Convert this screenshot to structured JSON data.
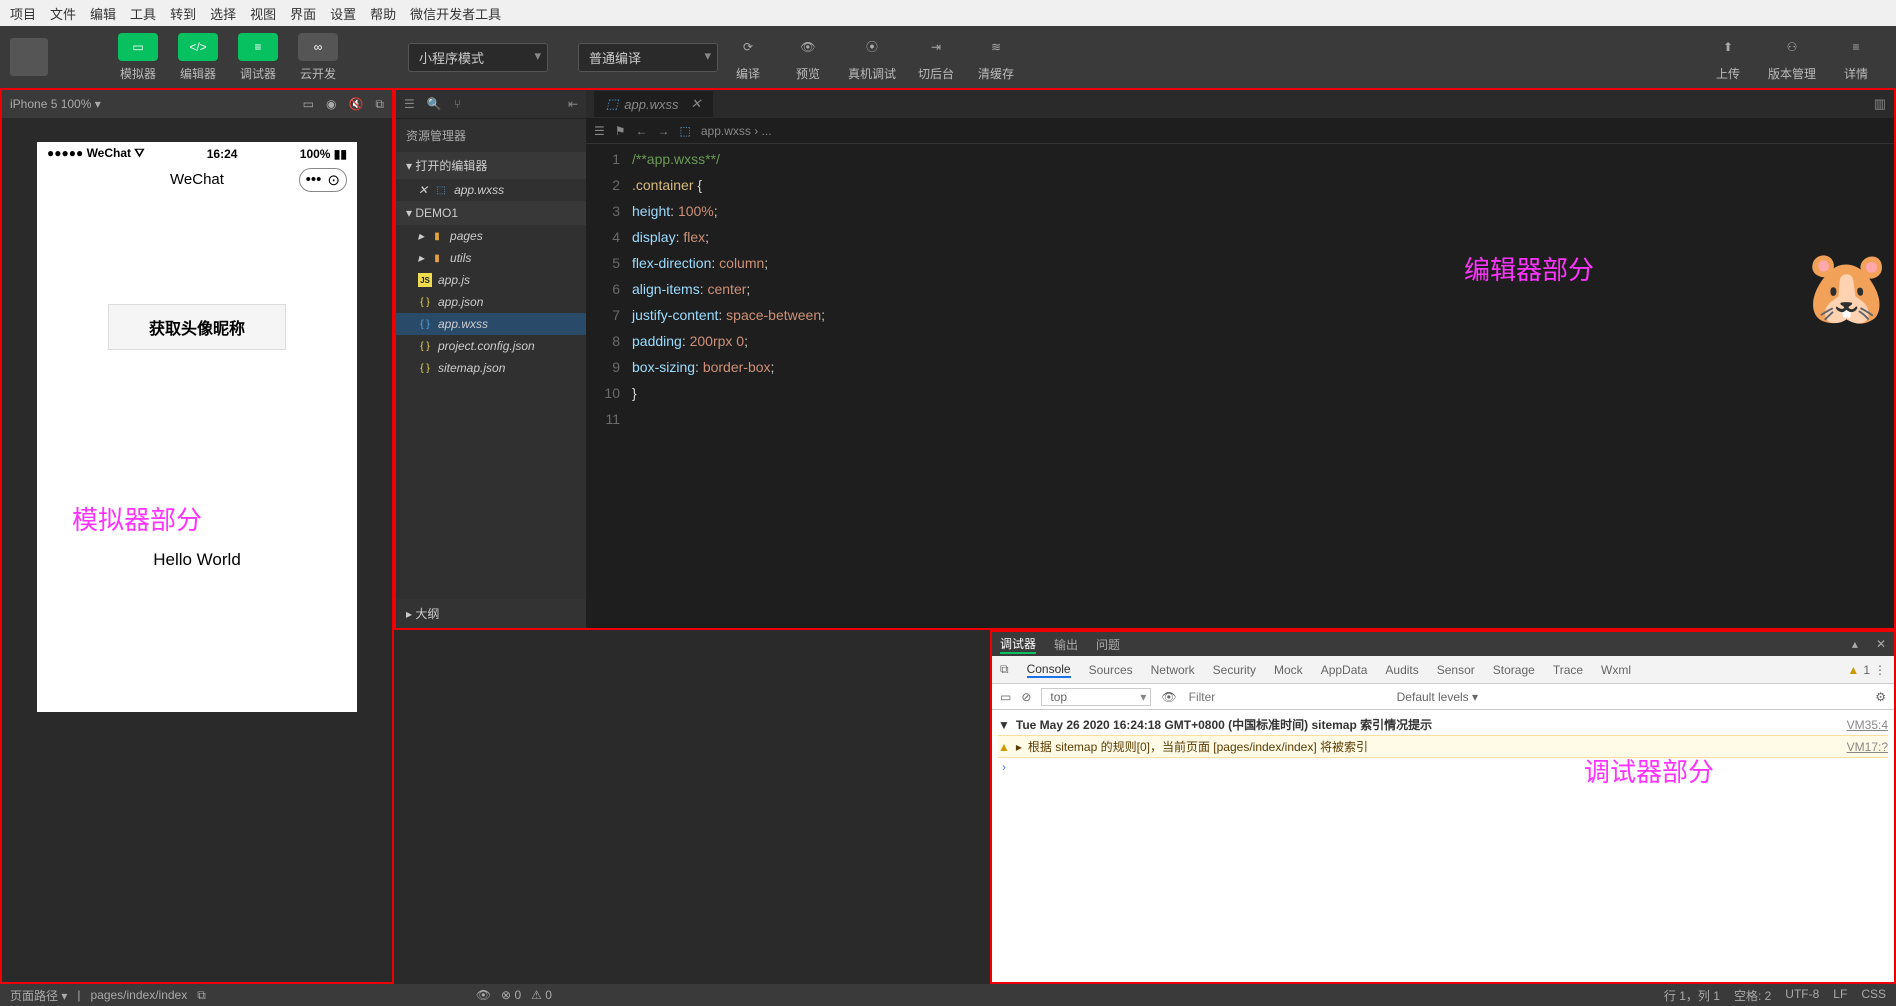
{
  "menubar": [
    "项目",
    "文件",
    "编辑",
    "工具",
    "转到",
    "选择",
    "视图",
    "界面",
    "设置",
    "帮助",
    "微信开发者工具"
  ],
  "toolbar": {
    "simulator": "模拟器",
    "editor": "编辑器",
    "debugger": "调试器",
    "cloud": "云开发",
    "mode_select": "小程序模式",
    "compile_select": "普通编译",
    "compile": "编译",
    "preview": "预览",
    "remote": "真机调试",
    "background": "切后台",
    "clear_cache": "清缓存",
    "upload": "上传",
    "version": "版本管理",
    "details": "详情"
  },
  "simulator": {
    "device": "iPhone 5 100% ▾",
    "status_carrier": "●●●●● WeChat ⛛",
    "status_time": "16:24",
    "status_batt": "100% ▮▮",
    "nav_title": "WeChat",
    "btn_label": "获取头像昵称",
    "hello": "Hello World",
    "annotation": "模拟器部分"
  },
  "explorer": {
    "title": "资源管理器",
    "open_editors": "打开的编辑器",
    "open_file": "app.wxss",
    "project": "DEMO1",
    "tree": [
      {
        "icon": "folder",
        "label": "pages"
      },
      {
        "icon": "folder",
        "label": "utils"
      },
      {
        "icon": "js",
        "label": "app.js"
      },
      {
        "icon": "json",
        "label": "app.json"
      },
      {
        "icon": "wxss",
        "label": "app.wxss",
        "active": true
      },
      {
        "icon": "json",
        "label": "project.config.json"
      },
      {
        "icon": "json",
        "label": "sitemap.json"
      }
    ],
    "outline": "大纲"
  },
  "editor": {
    "tab": "app.wxss",
    "breadcrumb": "app.wxss › ...",
    "lines": [
      {
        "n": 1,
        "html": "<span class='c-comment'>/**app.wxss**/</span>"
      },
      {
        "n": 2,
        "html": "<span class='c-sel'>.container</span> <span class='c-brace'>{</span>"
      },
      {
        "n": 3,
        "html": "  <span class='c-prop'>height</span><span class='c-punc'>:</span> <span class='c-val'>100%</span><span class='c-punc'>;</span>"
      },
      {
        "n": 4,
        "html": "  <span class='c-prop'>display</span><span class='c-punc'>:</span> <span class='c-val'>flex</span><span class='c-punc'>;</span>"
      },
      {
        "n": 5,
        "html": "  <span class='c-prop'>flex-direction</span><span class='c-punc'>:</span> <span class='c-val'>column</span><span class='c-punc'>;</span>"
      },
      {
        "n": 6,
        "html": "  <span class='c-prop'>align-items</span><span class='c-punc'>:</span> <span class='c-val'>center</span><span class='c-punc'>;</span>"
      },
      {
        "n": 7,
        "html": "  <span class='c-prop'>justify-content</span><span class='c-punc'>:</span> <span class='c-val'>space-between</span><span class='c-punc'>;</span>"
      },
      {
        "n": 8,
        "html": "  <span class='c-prop'>padding</span><span class='c-punc'>:</span> <span class='c-val'>200rpx 0</span><span class='c-punc'>;</span>"
      },
      {
        "n": 9,
        "html": "  <span class='c-prop'>box-sizing</span><span class='c-punc'>:</span> <span class='c-val'>border-box</span><span class='c-punc'>;</span>"
      },
      {
        "n": 10,
        "html": "<span class='c-brace'>}</span>"
      },
      {
        "n": 11,
        "html": ""
      }
    ],
    "annotation": "编辑器部分"
  },
  "debugger": {
    "tabs1": [
      "调试器",
      "输出",
      "问题"
    ],
    "tabs2": [
      "Console",
      "Sources",
      "Network",
      "Security",
      "Mock",
      "AppData",
      "Audits",
      "Sensor",
      "Storage",
      "Trace",
      "Wxml"
    ],
    "warn_count": "1",
    "context": "top",
    "filter_placeholder": "Filter",
    "levels": "Default levels ▾",
    "log1_text": "Tue May 26 2020 16:24:18 GMT+0800 (中国标准时间) sitemap 索引情况提示",
    "log1_src": "VM35:4",
    "log2_text": "根据 sitemap 的规则[0]，当前页面 [pages/index/index] 将被索引",
    "log2_src": "VM17:?",
    "annotation": "调试器部分"
  },
  "statusbar": {
    "path_label": "页面路径 ▾",
    "path": "pages/index/index",
    "errs": "0",
    "warns": "0",
    "pos": "行 1，列 1",
    "spaces": "空格: 2",
    "enc": "UTF-8",
    "eol": "LF",
    "lang": "CSS"
  }
}
